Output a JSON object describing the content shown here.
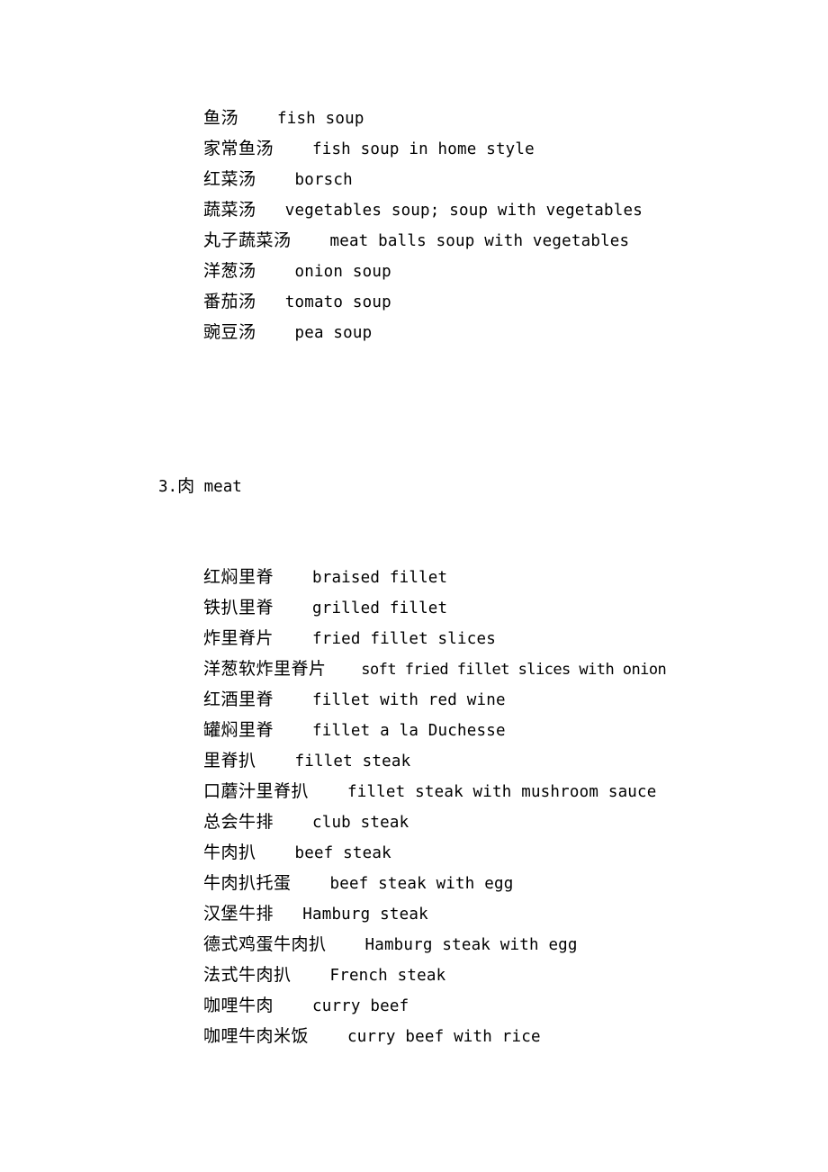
{
  "document": {
    "page_background": "#ffffff",
    "text_color": "#000000"
  },
  "sections": [
    {
      "id": "soups",
      "heading": null,
      "entries": [
        {
          "term": "鱼汤",
          "spacer": "    ",
          "gloss": "fish soup"
        },
        {
          "term": "家常鱼汤",
          "spacer": "    ",
          "gloss": "fish soup in home style"
        },
        {
          "term": "红菜汤",
          "spacer": "    ",
          "gloss": "borsch"
        },
        {
          "term": "蔬菜汤",
          "spacer": "   ",
          "gloss": "vegetables soup; soup with vegetables"
        },
        {
          "term": "丸子蔬菜汤",
          "spacer": "    ",
          "gloss": "meat balls soup with vegetables"
        },
        {
          "term": "洋葱汤",
          "spacer": "    ",
          "gloss": "onion soup"
        },
        {
          "term": "番茄汤",
          "spacer": "   ",
          "gloss": "tomato soup"
        },
        {
          "term": "豌豆汤",
          "spacer": "    ",
          "gloss": "pea soup"
        }
      ]
    },
    {
      "id": "meat",
      "heading": {
        "number": "3.",
        "term": "肉",
        "spacer": " ",
        "gloss": "meat"
      },
      "entries": [
        {
          "term": "红焖里脊",
          "spacer": "    ",
          "gloss": "braised fillet"
        },
        {
          "term": "铁扒里脊",
          "spacer": "    ",
          "gloss": "grilled fillet"
        },
        {
          "term": "炸里脊片",
          "spacer": "    ",
          "gloss": "fried fillet slices"
        },
        {
          "term": "洋葱软炸里脊片",
          "spacer": "    ",
          "gloss": "soft fried fillet slices with onion",
          "condensed": true
        },
        {
          "term": "红酒里脊",
          "spacer": "    ",
          "gloss": "fillet with red wine"
        },
        {
          "term": "罐焖里脊",
          "spacer": "    ",
          "gloss": "fillet a la Duchesse"
        },
        {
          "term": "里脊扒",
          "spacer": "    ",
          "gloss": "fillet steak"
        },
        {
          "term": "口蘑汁里脊扒",
          "spacer": "    ",
          "gloss": "fillet steak with mushroom sauce"
        },
        {
          "term": "总会牛排",
          "spacer": "    ",
          "gloss": "club steak"
        },
        {
          "term": "牛肉扒",
          "spacer": "    ",
          "gloss": "beef steak"
        },
        {
          "term": "牛肉扒托蛋",
          "spacer": "    ",
          "gloss": "beef steak with egg"
        },
        {
          "term": "汉堡牛排",
          "spacer": "   ",
          "gloss": "Hamburg steak"
        },
        {
          "term": "德式鸡蛋牛肉扒",
          "spacer": "    ",
          "gloss": "Hamburg steak with egg"
        },
        {
          "term": "法式牛肉扒",
          "spacer": "    ",
          "gloss": "French steak"
        },
        {
          "term": "咖哩牛肉",
          "spacer": "    ",
          "gloss": "curry beef"
        },
        {
          "term": "咖哩牛肉米饭",
          "spacer": "    ",
          "gloss": "curry beef with rice"
        }
      ]
    }
  ]
}
